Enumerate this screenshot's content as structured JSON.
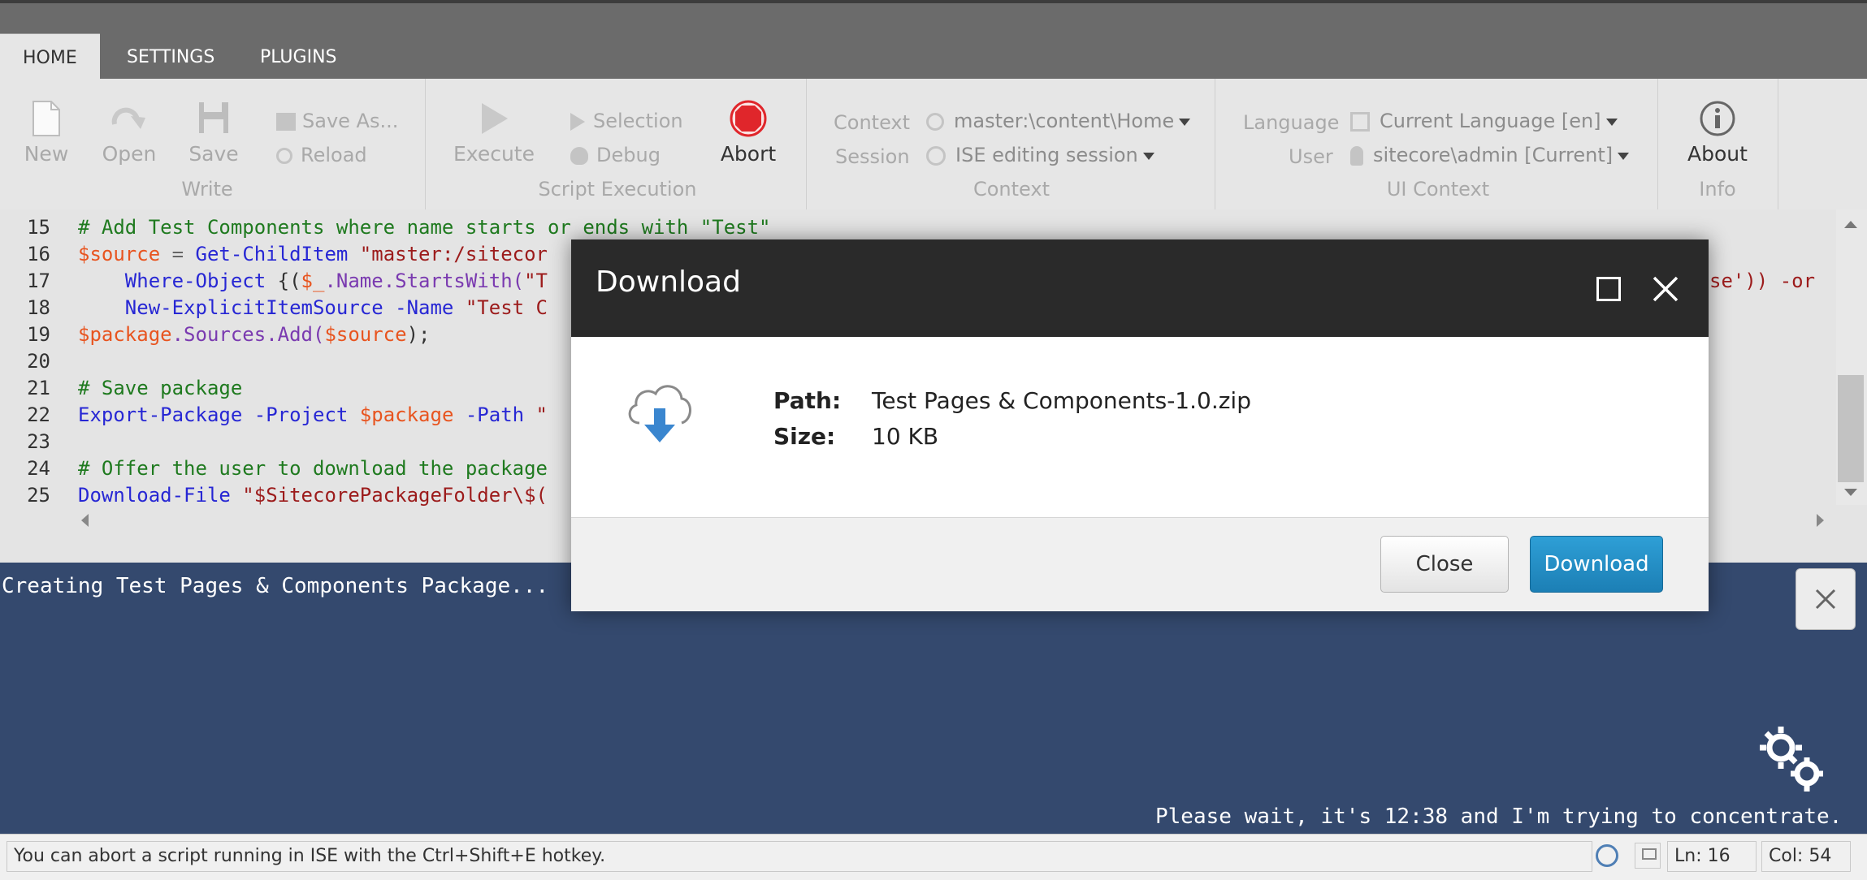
{
  "tabs": [
    {
      "label": "HOME",
      "active": true
    },
    {
      "label": "SETTINGS",
      "active": false
    },
    {
      "label": "PLUGINS",
      "active": false
    }
  ],
  "ribbon": {
    "write": {
      "new": "New",
      "open": "Open",
      "save": "Save",
      "save_as": "Save As...",
      "reload": "Reload",
      "group": "Write"
    },
    "script_execution": {
      "execute": "Execute",
      "selection": "Selection",
      "debug": "Debug",
      "abort": "Abort",
      "group": "Script Execution"
    },
    "context": {
      "context_label": "Context",
      "context_value": "master:\\content\\Home",
      "session_label": "Session",
      "session_value": "ISE editing session",
      "group": "Context"
    },
    "ui_context": {
      "language_label": "Language",
      "language_value": "Current Language [en]",
      "user_label": "User",
      "user_value": "sitecore\\admin [Current]",
      "group": "UI Context"
    },
    "info": {
      "about": "About",
      "group": "Info"
    }
  },
  "editor": {
    "line_numbers": [
      "15",
      "16",
      "17",
      "18",
      "19",
      "20",
      "21",
      "22",
      "23",
      "24",
      "25"
    ],
    "line15": "# Add Test Components where name starts or ends with \"Test\"",
    "line16": {
      "var": "$source",
      "op": " = ",
      "cmd": "Get-ChildItem",
      "str": " \"master:/sitecor"
    },
    "line17": {
      "cmd": "    Where-Object",
      "plain": " {(",
      "var": "$_",
      "prop": ".Name.StartsWith(",
      "str": "\"T",
      "tail": "se')) -or "
    },
    "line18": {
      "cmd": "    New-ExplicitItemSource",
      "param": " -Name",
      "str": " \"Test C"
    },
    "line19": {
      "var": "$package",
      "prop": ".Sources.Add(",
      "var2": "$source",
      "plain": ");"
    },
    "line21": "# Save package",
    "line22": {
      "cmd": "Export-Package",
      "param": " -Project",
      "var": " $package",
      "param2": " -Path",
      "str": " \""
    },
    "line24": "# Offer the user to download the package",
    "line25": {
      "cmd": "Download-File",
      "str": " \"$SitecorePackageFolder\\$("
    }
  },
  "console": {
    "line1": "Creating Test Pages & Components Package...",
    "wait_message": "Please wait, it's 12:38 and I'm trying to concentrate."
  },
  "status": {
    "hint": "You can abort a script running in ISE with the Ctrl+Shift+E hotkey.",
    "line": "Ln: 16",
    "col": "Col: 54"
  },
  "dialog": {
    "title": "Download",
    "path_label": "Path:",
    "path_value": "Test Pages & Components-1.0.zip",
    "size_label": "Size:",
    "size_value": "10 KB",
    "close_button": "Close",
    "download_button": "Download"
  },
  "colors": {
    "accent": "#1c7fb5",
    "console_bg": "#34496e",
    "abort_red": "#e0262b"
  }
}
